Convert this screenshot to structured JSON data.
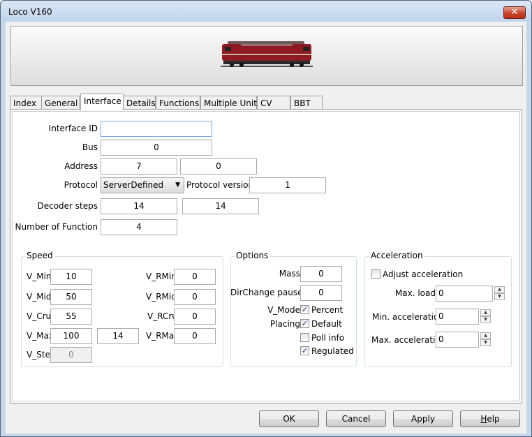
{
  "window": {
    "title": "Loco V160",
    "close_glyph": "✕"
  },
  "tabs": [
    "Index",
    "General",
    "Interface",
    "Details",
    "Functions",
    "Multiple Unit",
    "CV",
    "BBT"
  ],
  "active_tab": "Interface",
  "interface": {
    "interface_id": {
      "label": "Interface ID",
      "value": ""
    },
    "bus": {
      "label": "Bus",
      "value": "0"
    },
    "address": {
      "label": "Address",
      "value": "7",
      "value2": "0"
    },
    "protocol": {
      "label": "Protocol",
      "value": "ServerDefined",
      "version_label": "Protocol version",
      "version_value": "1"
    },
    "decoder_steps": {
      "label": "Decoder steps",
      "value": "14",
      "value2": "14"
    },
    "number_of_function": {
      "label": "Number of Function",
      "value": "4"
    }
  },
  "speed": {
    "title": "Speed",
    "v_min": {
      "label": "V_Min",
      "value": "10"
    },
    "v_mid": {
      "label": "V_Mid",
      "value": "50"
    },
    "v_cru": {
      "label": "V_Cru",
      "value": "55"
    },
    "v_max": {
      "label": "V_Max",
      "value": "100",
      "value2": "14"
    },
    "v_step": {
      "label": "V_Step",
      "value": "0"
    },
    "v_rmin": {
      "label": "V_RMin",
      "value": "0"
    },
    "v_rmid": {
      "label": "V_RMid",
      "value": "0"
    },
    "v_rcru": {
      "label": "V_RCru",
      "value": "0"
    },
    "v_rmax": {
      "label": "V_RMax",
      "value": "0"
    }
  },
  "options": {
    "title": "Options",
    "mass": {
      "label": "Mass",
      "value": "0"
    },
    "dirchange": {
      "label": "DirChange pause",
      "value": "0"
    },
    "v_mode": {
      "label": "V_Mode",
      "option": "Percent",
      "checked": true
    },
    "placing": {
      "label": "Placing",
      "option": "Default",
      "checked": true
    },
    "poll_info": {
      "option": "Poll info",
      "checked": false
    },
    "regulated": {
      "option": "Regulated",
      "checked": true
    },
    "check_glyph": "✓"
  },
  "acceleration": {
    "title": "Acceleration",
    "adjust": {
      "label": "Adjust acceleration",
      "checked": false
    },
    "max_load": {
      "label": "Max. load",
      "value": "0"
    },
    "min_accel": {
      "label": "Min. acceleration",
      "value": "0"
    },
    "max_accel": {
      "label": "Max. acceleration",
      "value": "0"
    },
    "spin_up": "▲",
    "spin_down": "▼"
  },
  "buttons": {
    "ok": "OK",
    "cancel": "Cancel",
    "apply": "Apply",
    "help_u": "H",
    "help_rest": "elp"
  },
  "colors": {
    "loco_body": "#8e1a24",
    "loco_roof": "#6f5a5a",
    "titlebar": "#c6d7ea",
    "close": "#c7442c"
  },
  "icons": {
    "combo_arrow": "▼"
  }
}
